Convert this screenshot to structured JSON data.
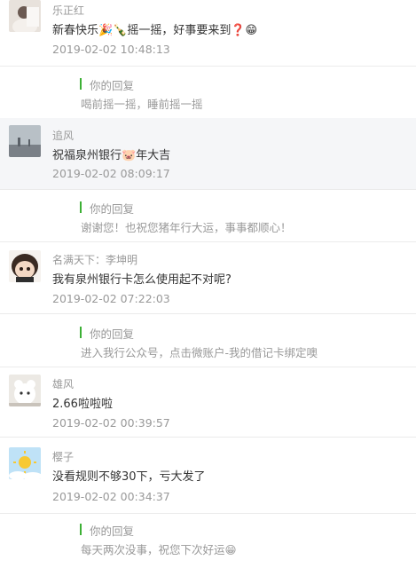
{
  "comments": [
    {
      "name": "乐正红",
      "text": "新春快乐🎉🍾摇一摇，好事要来到❓😁",
      "time": "2019-02-02 10:48:13",
      "reply_label": "你的回复",
      "reply_text": "喝前摇一摇，睡前摇一摇"
    },
    {
      "name": "追风",
      "text": "祝福泉州银行🐷年大吉",
      "time": "2019-02-02 08:09:17",
      "reply_label": "你的回复",
      "reply_text": "谢谢您！也祝您猪年行大运，事事都顺心！"
    },
    {
      "name": "名满天下：李坤明",
      "text": "我有泉州银行卡怎么使用起不对呢?",
      "time": "2019-02-02 07:22:03",
      "reply_label": "你的回复",
      "reply_text": "进入我行公众号，点击微账户-我的借记卡绑定噢"
    },
    {
      "name": "雄风",
      "text": "2.66啦啦啦",
      "time": "2019-02-02 00:39:57"
    },
    {
      "name": "樱子",
      "text": "没看规则不够30下，亏大发了",
      "time": "2019-02-02 00:34:37",
      "reply_label": "你的回复",
      "reply_text": "每天两次没事，祝您下次好运😁"
    }
  ],
  "colors": {
    "accent_bar": "#3cb035",
    "meta_text": "#999999",
    "body_text": "#333333",
    "highlight_bg": "#f5f6f8"
  }
}
